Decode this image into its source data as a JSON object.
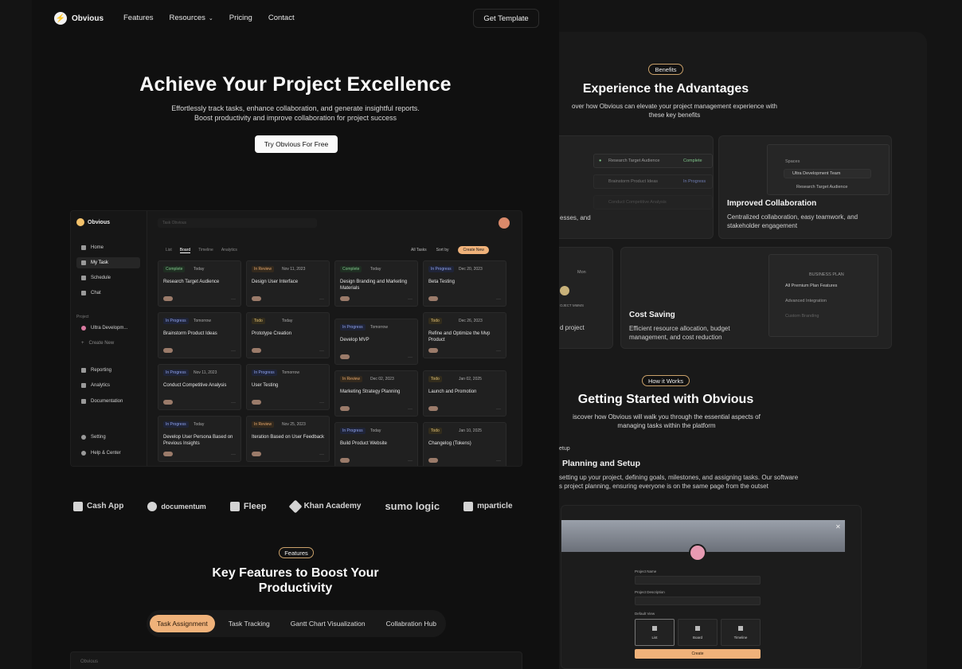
{
  "nav": {
    "logo": "Obvious",
    "links": [
      "Features",
      "Resources",
      "Pricing",
      "Contact"
    ],
    "cta": "Get Template"
  },
  "hero": {
    "title": "Achieve Your Project Excellence",
    "subtitle": "Effortlessly track tasks, enhance collaboration, and generate insightful reports. Boost productivity and improve collaboration for project success",
    "cta": "Try Obvious For Free"
  },
  "dashboard": {
    "logo": "Obvious",
    "search_placeholder": "Task Obvious",
    "sidebar": [
      "Home",
      "My Task",
      "Schedule",
      "Chat"
    ],
    "project_caption": "Project",
    "projects": [
      "Ultra Developm...",
      "Create New"
    ],
    "sidebar_bottom": [
      "Reporting",
      "Analytics",
      "Documentation"
    ],
    "sidebar_footer": [
      "Setting",
      "Help & Center"
    ],
    "tabs": [
      "List",
      "Board",
      "Timeline",
      "Analytics"
    ],
    "filter_all": "All Tasks",
    "filter_sort": "Sort by",
    "create_new": "Create New",
    "columns": [
      [
        {
          "status": "Complete",
          "date": "Today",
          "title": "Research Target Audience",
          "kind": "complete"
        },
        {
          "status": "In Progress",
          "date": "Tomorrow",
          "title": "Brainstorm Product Ideas",
          "kind": "prog"
        },
        {
          "status": "In Progress",
          "date": "Nov 11, 2023",
          "title": "Conduct Competitive Analysis",
          "kind": "prog"
        },
        {
          "status": "In Progress",
          "date": "Today",
          "title": "Develop User Persona Based on Previous Insights",
          "kind": "prog"
        }
      ],
      [
        {
          "status": "In Review",
          "date": "Nov 11, 2023",
          "title": "Design User Interface",
          "kind": "review"
        },
        {
          "status": "Todo",
          "date": "Today",
          "title": "Prototype Creation",
          "kind": "todo"
        },
        {
          "status": "In Progress",
          "date": "Tomorrow",
          "title": "User Testing",
          "kind": "prog"
        },
        {
          "status": "In Review",
          "date": "Nov 25, 2023",
          "title": "Iteration Based on User Feedback",
          "kind": "review"
        }
      ],
      [
        {
          "status": "Complete",
          "date": "Today",
          "title": "Design Branding and Marketing Materials",
          "kind": "complete"
        },
        {
          "status": "In Progress",
          "date": "Tomorrow",
          "title": "Develop MVP",
          "kind": "prog"
        },
        {
          "status": "In Review",
          "date": "Dec 02, 2023",
          "title": "Marketing Strategy Planning",
          "kind": "review"
        },
        {
          "status": "In Progress",
          "date": "Today",
          "title": "Build Product Website",
          "kind": "prog"
        }
      ],
      [
        {
          "status": "In Progress",
          "date": "Dec 20, 2023",
          "title": "Beta Testing",
          "kind": "prog"
        },
        {
          "status": "Todo",
          "date": "Dec 26, 2023",
          "title": "Refine and Optimize the Mvp Product",
          "kind": "todo"
        },
        {
          "status": "Todo",
          "date": "Jan 02, 2025",
          "title": "Launch and Promotion",
          "kind": "todo"
        },
        {
          "status": "Todo",
          "date": "Jan 10, 2025",
          "title": "Changelog (Tokens)",
          "kind": "todo"
        }
      ]
    ]
  },
  "partner_logos": [
    "Cash App",
    "documentum",
    "Fleep",
    "Khan Academy",
    "sumo logic",
    "mparticle"
  ],
  "features": {
    "pill": "Features",
    "title_line1": "Key Features to Boost Your",
    "title_line2": "Productivity",
    "tabs": [
      "Task Assignment",
      "Task Tracking",
      "Gantt Chart Visualization",
      "Collabration Hub"
    ],
    "mock_logo": "Obvious"
  },
  "benefits": {
    "pill": "Benefits",
    "title": "Experience the Advantages",
    "subtitle_line1": "over how Obvious can elevate your project management experience with",
    "subtitle_line2": "these key benefits",
    "card1_fragment": "esses, and",
    "card1_list": [
      "Research Target Audience",
      "Brainstorm Product Ideas",
      "Conduct Competitive Analysis"
    ],
    "card1_status": [
      "Complete",
      "In Progress"
    ],
    "card2": {
      "title": "Improved Collaboration",
      "desc": "Centralized collaboration, easy teamwork, and stakeholder engagement",
      "mini_caption": "Spaces",
      "mini_team": "Ultra Development Team",
      "mini_item": "Research Target Audience"
    },
    "card3_fragment": "d project",
    "card3_mini": [
      "Mon",
      "OJECT MMMS"
    ],
    "card4": {
      "title": "Cost Saving",
      "desc": "Efficient resource allocation, budget management, and cost reduction",
      "plan_caption": "BUSINESS PLAN",
      "plan_items": [
        "All Premium Plan Features",
        "Advanced Integration",
        "Custom Branding"
      ]
    }
  },
  "how": {
    "pill": "How it Works",
    "title": "Getting Started with Obvious",
    "subtitle_line1": "iscover how Obvious will walk you through the essential aspects of",
    "subtitle_line2": "managing tasks within the platform",
    "step_caption": "etup",
    "step_title": "Planning and Setup",
    "step_desc_line1": "setting up your project, defining goals, milestones, and assigning tasks. Our software",
    "step_desc_line2": "s project planning, ensuring everyone is on the same page from the outset",
    "modal": {
      "label_name": "Project Name",
      "label_desc": "Project Description",
      "label_view": "Default View",
      "views": [
        "List",
        "Board",
        "Timeline"
      ],
      "create": "Create"
    }
  }
}
